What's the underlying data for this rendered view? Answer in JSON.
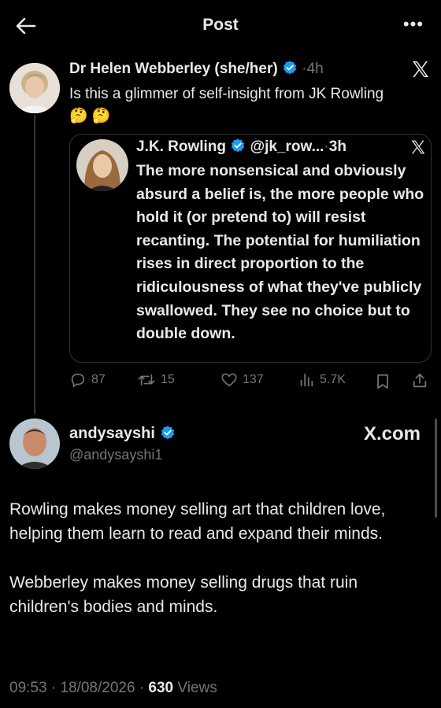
{
  "header": {
    "title": "Post"
  },
  "tweet1": {
    "author": "Dr Helen Webberley (she/her)",
    "time": "4h",
    "separator": "·",
    "text": "Is this a glimmer of self-insight from JK Rowling",
    "emojis": "🤔 🤔",
    "quote": {
      "author": "J.K. Rowling",
      "handle": "@jk_row...",
      "time": "3h",
      "separator": "·",
      "text": "The more nonsensical and obviously absurd a belief is, the more people who hold it (or pretend to) will resist recanting. The potential for humiliation rises in direct proportion to the ridiculousness of what they've publicly swallowed. They see no choice but to double down."
    },
    "actions": {
      "replies": "87",
      "reposts": "15",
      "likes": "137",
      "views": "5.7K"
    }
  },
  "tweet2": {
    "author": "andysayshi",
    "handle": "@andysayshi1",
    "source": "X.com",
    "paragraphs": [
      "Rowling makes money selling art that children love, helping them learn to read and expand their minds.",
      "Webberley makes money selling drugs that ruin children's bodies and minds."
    ],
    "time": "09:53",
    "date": "18/08/2026",
    "separator": "·",
    "views_count": "630",
    "views_label": "Views"
  },
  "colors": {
    "background": "#000000",
    "text": "#e7e9ea",
    "muted": "#71767b",
    "verified": "#1d9bf0",
    "border": "#2f3336"
  },
  "icons": [
    "back-arrow-icon",
    "more-icon",
    "verified-icon",
    "x-logo-icon",
    "reply-icon",
    "repost-icon",
    "like-icon",
    "views-icon",
    "bookmark-icon",
    "share-icon"
  ]
}
